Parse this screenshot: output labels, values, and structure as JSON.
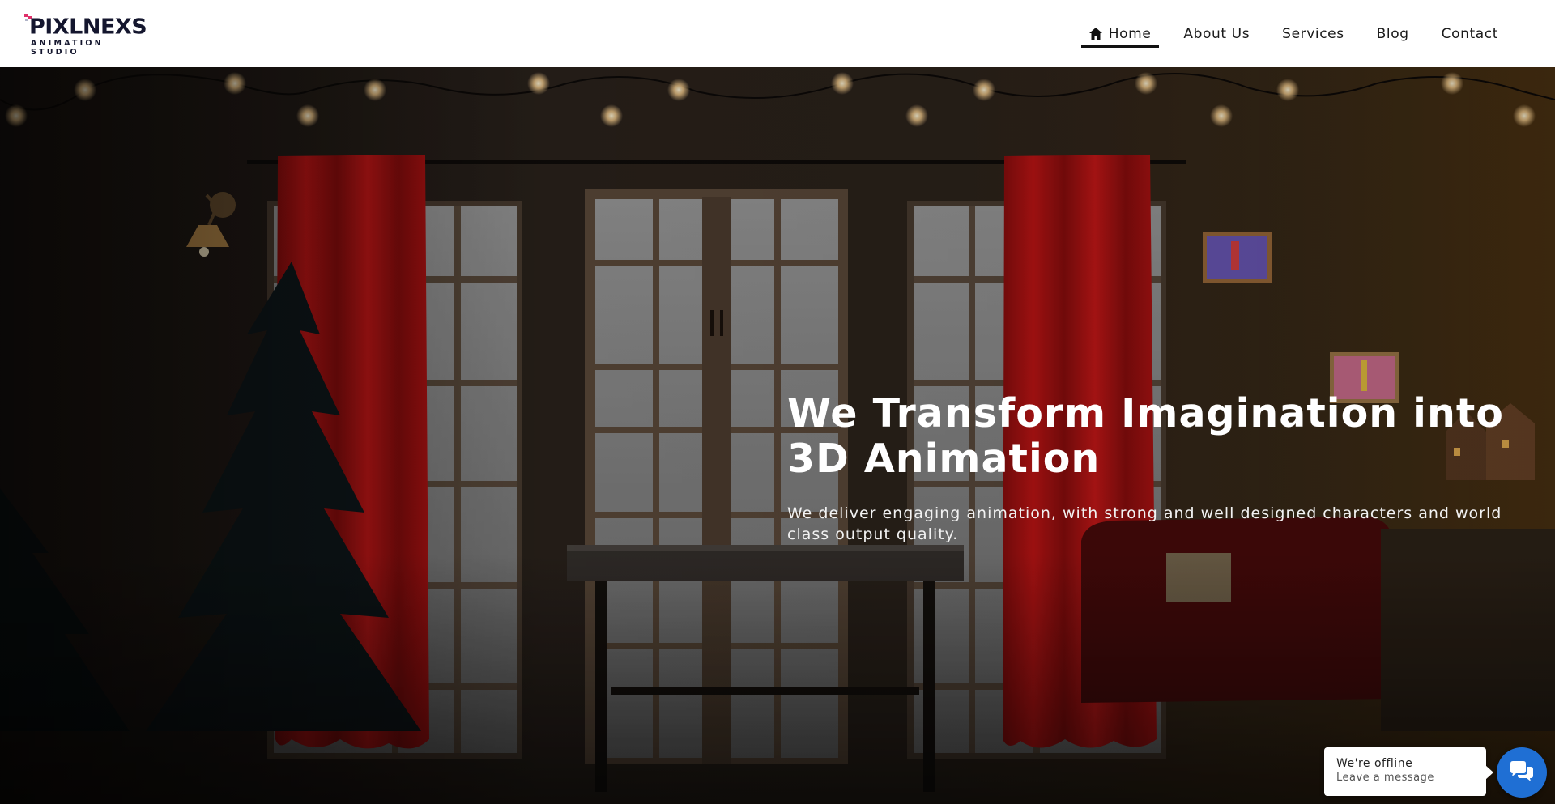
{
  "header": {
    "logo": {
      "main": "PIXLNEXS",
      "sub": "ANIMATION STUDIO",
      "mark_color": "#e0306a"
    },
    "nav": [
      {
        "label": "Home",
        "icon": "home-icon",
        "active": true
      },
      {
        "label": "About Us"
      },
      {
        "label": "Services"
      },
      {
        "label": "Blog"
      },
      {
        "label": "Contact"
      }
    ]
  },
  "hero": {
    "title": "We Transform Imagination into 3D Animation",
    "subtitle": "We deliver engaging animation, with strong and well designed characters and world class output quality."
  },
  "chat": {
    "status": "We're offline",
    "message": "Leave a message",
    "icon": "chat-bubbles-icon",
    "accent": "#1f6fd4"
  }
}
